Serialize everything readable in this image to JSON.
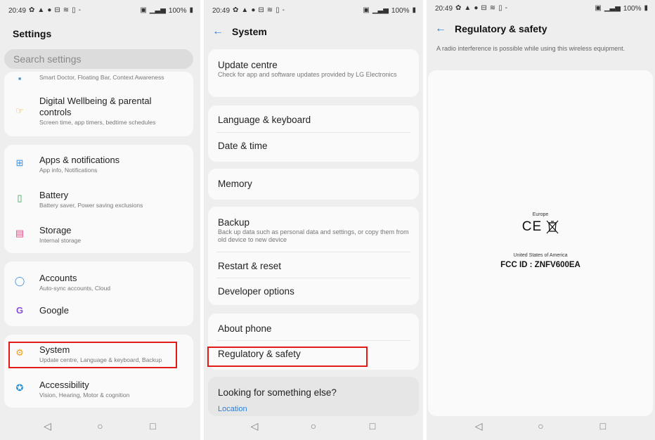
{
  "status_bar": {
    "time": "20:49",
    "battery": "100%"
  },
  "icons": {
    "status_left": [
      "gear-icon",
      "warning-icon",
      "dot-icon",
      "mail-icon",
      "wifi-icon",
      "square-icon",
      "minus-icon"
    ],
    "status_right": [
      "nfc-icon",
      "signal-icon",
      "battery-icon"
    ],
    "nav": [
      "back-icon",
      "home-icon",
      "recents-icon"
    ]
  },
  "colors": {
    "accent": "#2f7fd8",
    "highlight": "#e11a1a",
    "background": "#eeeeee",
    "card": "#fafafa"
  },
  "settings": {
    "title": "Settings",
    "search_placeholder": "Search settings",
    "partial_subtitle": "Smart Doctor, Floating Bar, Context Awareness",
    "items": [
      {
        "title": "Digital Wellbeing & parental controls",
        "subtitle": "Screen time, app timers, bedtime schedules",
        "icon": "hand-icon",
        "color": "#f0a020"
      },
      {
        "title": "Apps & notifications",
        "subtitle": "App info, Notifications",
        "icon": "apps-grid-icon",
        "color": "#3a8fe0"
      },
      {
        "title": "Battery",
        "subtitle": "Battery saver, Power saving exclusions",
        "icon": "battery-icon",
        "color": "#2aa84a"
      },
      {
        "title": "Storage",
        "subtitle": "Internal storage",
        "icon": "storage-icon",
        "color": "#e0508a"
      },
      {
        "title": "Accounts",
        "subtitle": "Auto-sync accounts, Cloud",
        "icon": "person-icon",
        "color": "#3a8fe0"
      },
      {
        "title": "Google",
        "subtitle": "",
        "icon": "google-icon",
        "color": "#8a4fd8"
      },
      {
        "title": "System",
        "subtitle": "Update centre, Language & keyboard, Backup",
        "icon": "gear-icon",
        "color": "#f0a020"
      },
      {
        "title": "Accessibility",
        "subtitle": "Vision, Hearing, Motor & cognition",
        "icon": "accessibility-icon",
        "color": "#2a8fd0"
      }
    ]
  },
  "system": {
    "title": "System",
    "items": [
      {
        "title": "Update centre",
        "subtitle": "Check for app and software updates provided by LG Electronics"
      },
      {
        "title": "Language & keyboard",
        "subtitle": ""
      },
      {
        "title": "Date & time",
        "subtitle": ""
      },
      {
        "title": "Memory",
        "subtitle": ""
      },
      {
        "title": "Backup",
        "subtitle": "Back up data such as personal data and settings, or copy them from old device to new device"
      },
      {
        "title": "Restart & reset",
        "subtitle": ""
      },
      {
        "title": "Developer options",
        "subtitle": ""
      },
      {
        "title": "About phone",
        "subtitle": ""
      },
      {
        "title": "Regulatory & safety",
        "subtitle": ""
      }
    ],
    "looking_title": "Looking for something else?",
    "looking_link": "Location"
  },
  "regulatory": {
    "title": "Regulatory & safety",
    "description": "A radio interference is possible while using this wireless equipment.",
    "europe_label": "Europe",
    "ce_mark": "CE",
    "usa_label": "United States of America",
    "fcc_id": "FCC ID : ZNFV600EA"
  }
}
